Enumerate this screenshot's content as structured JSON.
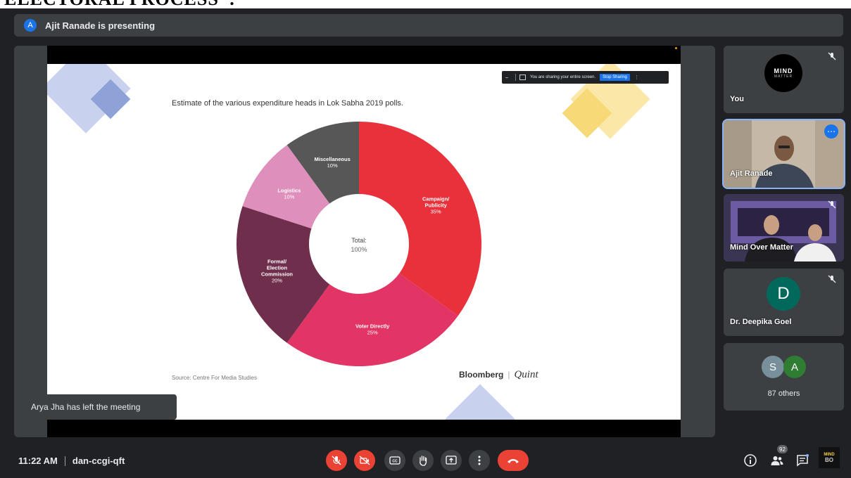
{
  "top_strip_text": "ELECTORAL PROCESS\".",
  "presenting": {
    "avatar_letter": "A",
    "label": "Ajit Ranade is presenting"
  },
  "share_bar": {
    "message": "You are sharing your entire screen.",
    "stop_label": "Stop Sharing"
  },
  "slide": {
    "title": "Estimate of the various expenditure heads in Lok Sabha 2019 polls.",
    "source": "Source: Centre For Media Studies",
    "brand_left": "Bloomberg",
    "brand_right": "Quint"
  },
  "chart_data": {
    "type": "pie",
    "subtype": "donut",
    "title": "Estimate of the various expenditure heads in Lok Sabha 2019 polls.",
    "center_label": "Total:",
    "center_value": "100%",
    "slices": [
      {
        "label_lines": [
          "Campaign/",
          "Publicity"
        ],
        "value": 35,
        "pct_label": "35%",
        "color": "#e8313a"
      },
      {
        "label_lines": [
          "Voter Directly"
        ],
        "value": 25,
        "pct_label": "25%",
        "color": "#e23566"
      },
      {
        "label_lines": [
          "Formal/",
          "Election",
          "Commission"
        ],
        "value": 20,
        "pct_label": "20%",
        "color": "#6f2e4c"
      },
      {
        "label_lines": [
          "Logistics"
        ],
        "value": 10,
        "pct_label": "10%",
        "color": "#de8fbb"
      },
      {
        "label_lines": [
          "Miscellaneous"
        ],
        "value": 10,
        "pct_label": "10%",
        "color": "#575757"
      }
    ]
  },
  "toast": "Arya Jha has left the meeting",
  "participants": {
    "you": {
      "name": "You",
      "logo_line1": "MIND",
      "logo_line2": "MATTER"
    },
    "presenter": {
      "name": "Ajit Ranade"
    },
    "group": {
      "name": "Mind Over Matter"
    },
    "deepika": {
      "name": "Dr. Deepika Goel",
      "initial": "D"
    },
    "others": {
      "initials": [
        "S",
        "A"
      ],
      "label": "87 others"
    }
  },
  "meeting": {
    "time": "11:22 AM",
    "code": "dan-ccgi-qft"
  },
  "people_count": "92",
  "corner_logo": {
    "line1": "MIND",
    "line2": "BO"
  },
  "colors": {
    "bg": "#202124",
    "panel": "#3c4043",
    "red": "#ea4335",
    "blue": "#1a73e8"
  }
}
